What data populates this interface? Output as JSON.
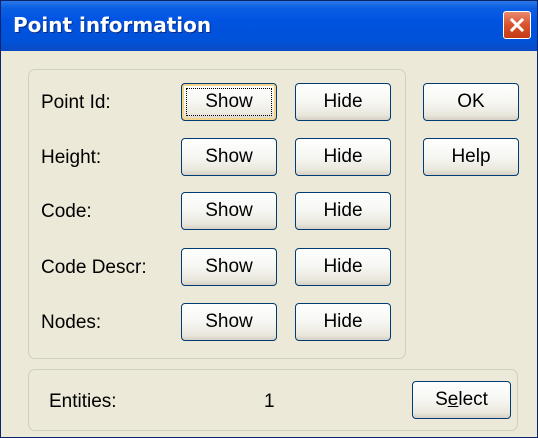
{
  "window": {
    "title": "Point information"
  },
  "rows": [
    {
      "label": "Point Id:",
      "show": "Show",
      "hide": "Hide"
    },
    {
      "label": "Height:",
      "show": "Show",
      "hide": "Hide"
    },
    {
      "label": "Code:",
      "show": "Show",
      "hide": "Hide"
    },
    {
      "label": "Code Descr:",
      "show": "Show",
      "hide": "Hide"
    },
    {
      "label": "Nodes:",
      "show": "Show",
      "hide": "Hide"
    }
  ],
  "side_buttons": {
    "ok": "OK",
    "help": "Help"
  },
  "entities": {
    "label": "Entities:",
    "count": "1",
    "select_prefix": "S",
    "select_mnemonic": "e",
    "select_suffix": "lect"
  },
  "icons": {
    "close": "close-x-icon"
  },
  "colors": {
    "titlebar": "#0053e1",
    "dialog_bg": "#ece9d8",
    "button_border": "#003c74",
    "close_button": "#d8532c"
  }
}
